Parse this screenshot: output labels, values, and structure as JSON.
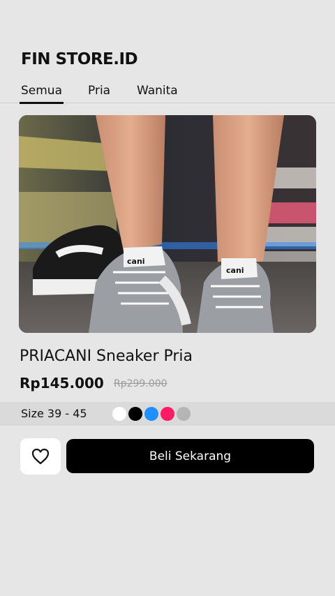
{
  "header": {
    "store_name": "FIN STORE.ID"
  },
  "tabs": [
    {
      "label": "Semua",
      "active": true
    },
    {
      "label": "Pria",
      "active": false
    },
    {
      "label": "Wanita",
      "active": false
    }
  ],
  "product": {
    "name": "PRIACANI Sneaker Pria",
    "price": "Rp145.000",
    "original_price": "Rp299.000",
    "size_label": "Size 39 - 45",
    "colors": [
      "#ffffff",
      "#000000",
      "#1e90ff",
      "#ff1a66",
      "#b5b5b5"
    ],
    "image_icon": "sneaker-photo",
    "brand_on_shoe": "cani"
  },
  "actions": {
    "favorite_icon": "heart-outline-icon",
    "buy_label": "Beli Sekarang"
  }
}
